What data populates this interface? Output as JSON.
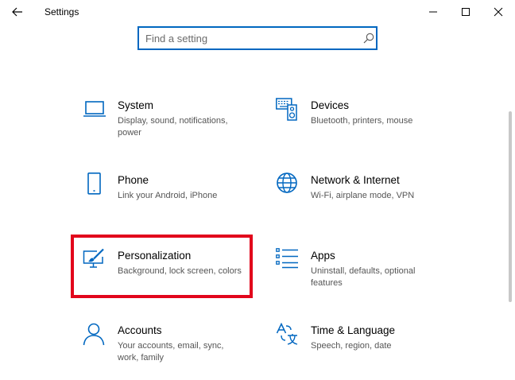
{
  "window": {
    "title": "Settings",
    "back_icon": "back-arrow-icon",
    "minimize_icon": "minimize-icon",
    "maximize_icon": "maximize-icon",
    "close_icon": "close-icon"
  },
  "search": {
    "placeholder": "Find a setting",
    "value": "",
    "icon": "search-icon"
  },
  "categories": [
    {
      "id": "system",
      "title": "System",
      "description": "Display, sound, notifications, power",
      "icon": "laptop-icon"
    },
    {
      "id": "devices",
      "title": "Devices",
      "description": "Bluetooth, printers, mouse",
      "icon": "keyboard-speaker-icon"
    },
    {
      "id": "phone",
      "title": "Phone",
      "description": "Link your Android, iPhone",
      "icon": "phone-icon"
    },
    {
      "id": "network",
      "title": "Network & Internet",
      "description": "Wi-Fi, airplane mode, VPN",
      "icon": "globe-icon"
    },
    {
      "id": "personalization",
      "title": "Personalization",
      "description": "Background, lock screen, colors",
      "icon": "paint-monitor-icon"
    },
    {
      "id": "apps",
      "title": "Apps",
      "description": "Uninstall, defaults, optional features",
      "icon": "apps-list-icon"
    },
    {
      "id": "accounts",
      "title": "Accounts",
      "description": "Your accounts, email, sync, work, family",
      "icon": "person-icon"
    },
    {
      "id": "time-language",
      "title": "Time & Language",
      "description": "Speech, region, date",
      "icon": "language-icon"
    }
  ],
  "highlight": {
    "target": "personalization",
    "color": "#e2061c"
  },
  "colors": {
    "accent": "#0067c0",
    "highlight": "#e2061c"
  }
}
